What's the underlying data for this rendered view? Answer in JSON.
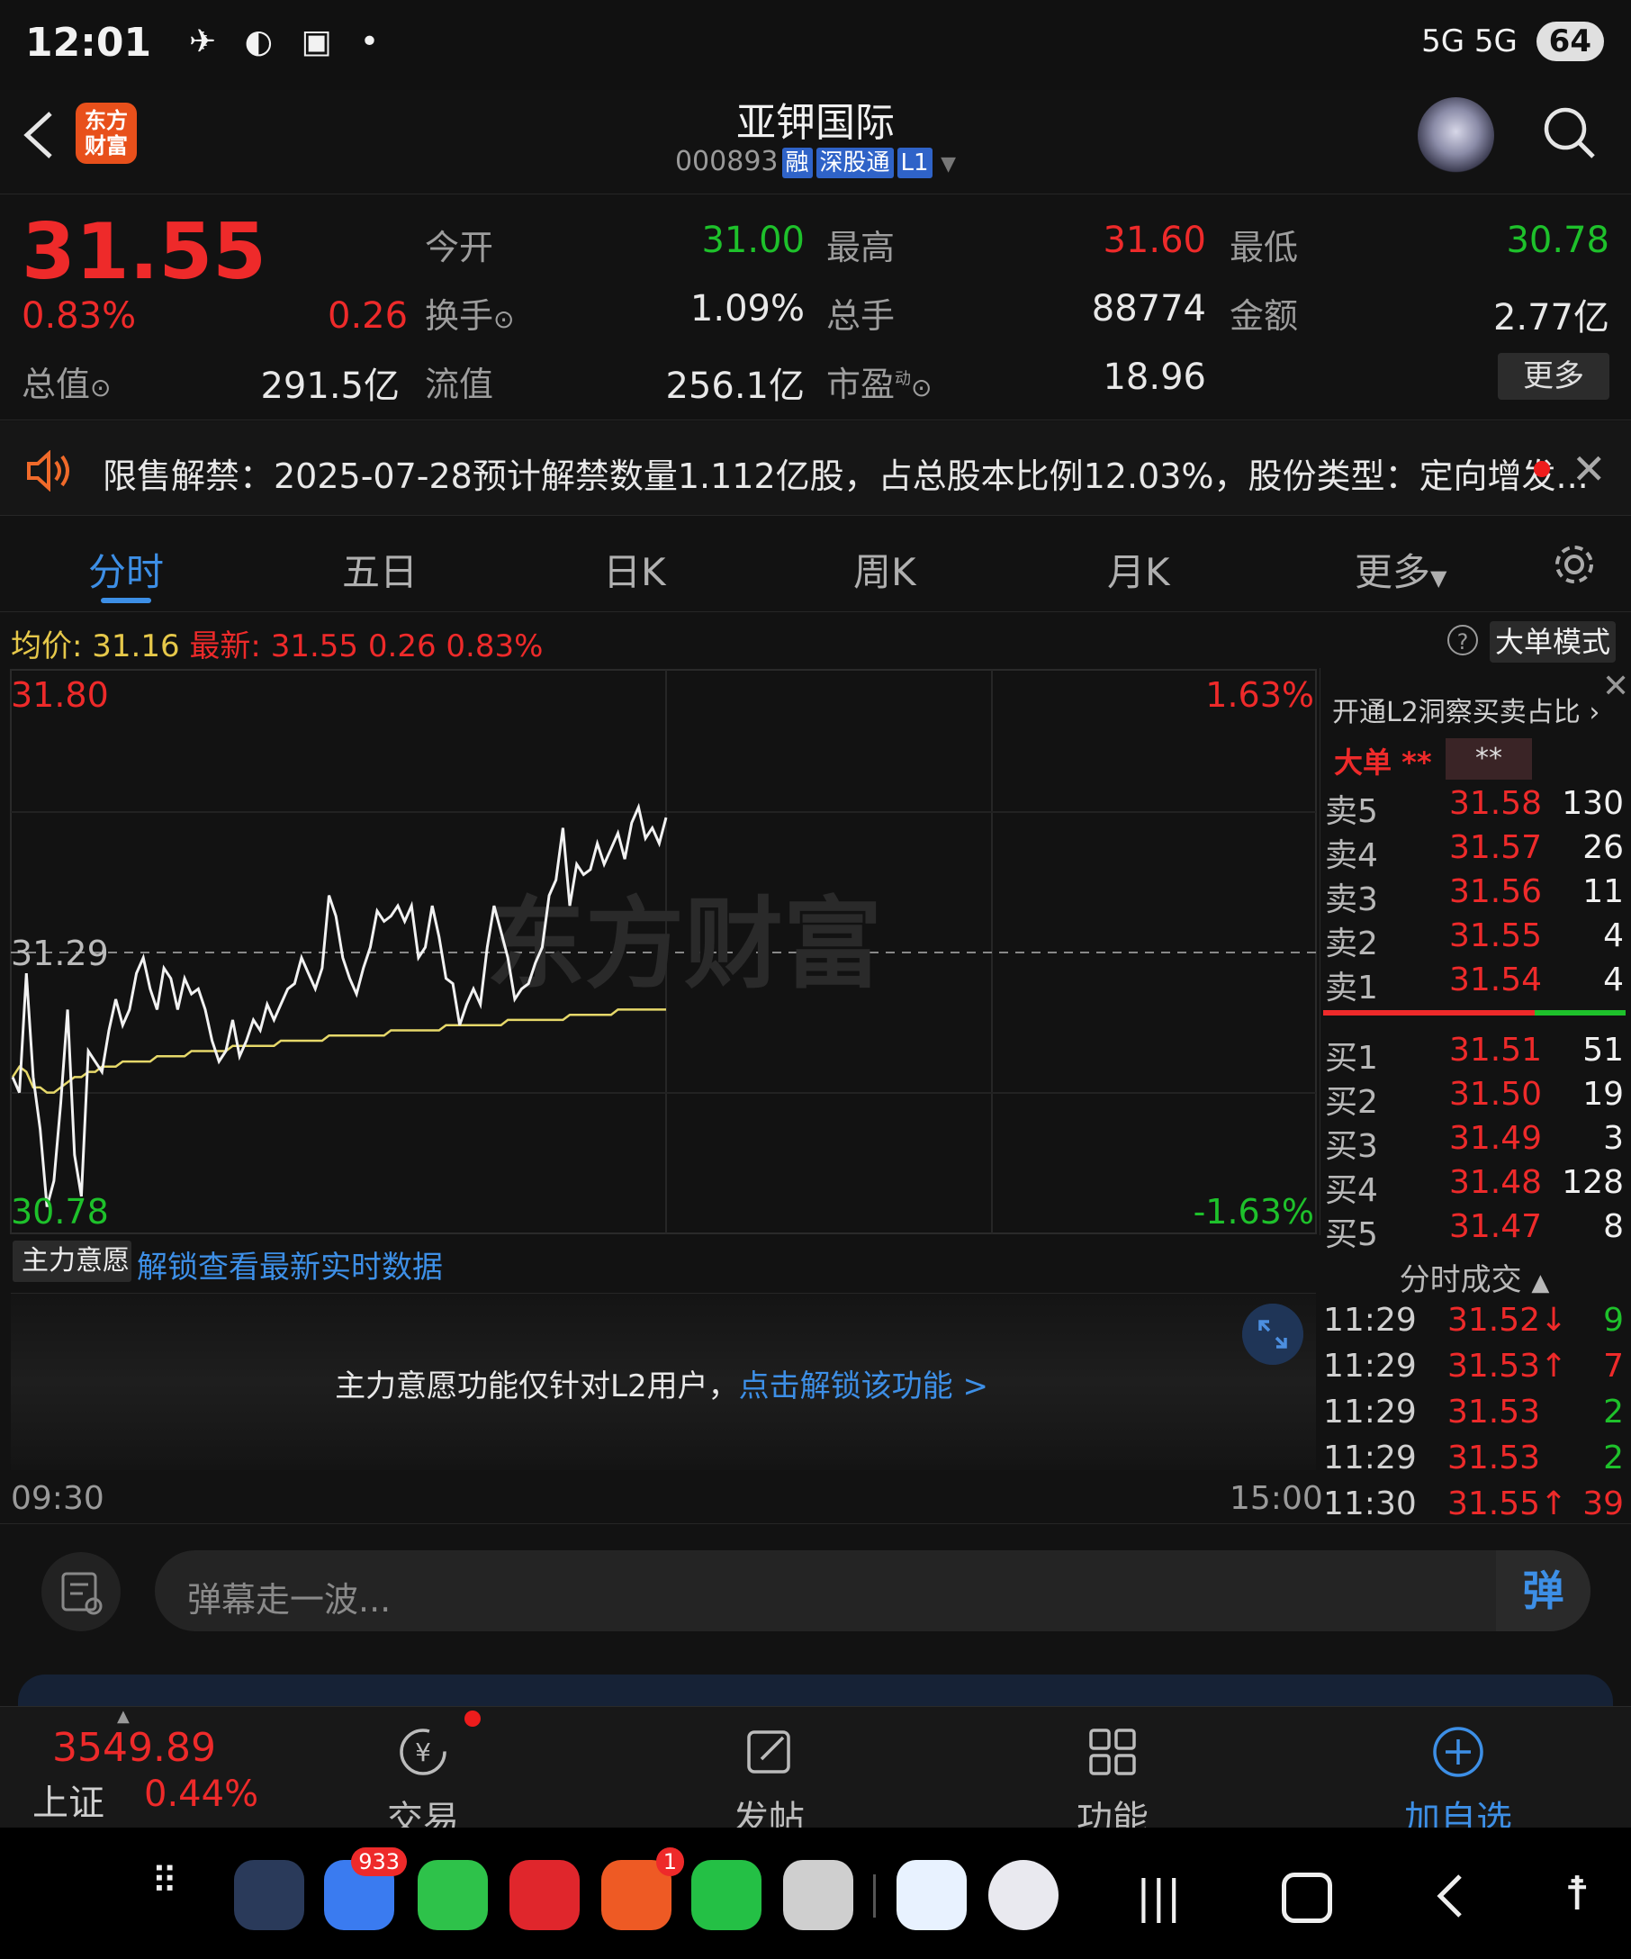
{
  "status_bar": {
    "time": "12:01",
    "network": "5G 5G",
    "battery": "64"
  },
  "header": {
    "logo_text": "东方\n财富",
    "stock_name": "亚钾国际",
    "stock_code": "000893",
    "tags": [
      "融",
      "深股通",
      "L1"
    ]
  },
  "quote": {
    "price": "31.55",
    "change_pct": "0.83%",
    "change": "0.26",
    "open_label": "今开",
    "open": "31.00",
    "high_label": "最高",
    "high": "31.60",
    "low_label": "最低",
    "low": "30.78",
    "turnover_label": "换手",
    "turnover": "1.09%",
    "volume_label": "总手",
    "volume": "88774",
    "amount_label": "金额",
    "amount": "2.77亿",
    "mktcap_label": "总值",
    "mktcap": "291.5亿",
    "float_label": "流值",
    "float_cap": "256.1亿",
    "pe_label": "市盈",
    "pe_super": "动",
    "pe": "18.96",
    "more_label": "更多"
  },
  "notice": {
    "text": "限售解禁：2025-07-28预计解禁数量1.112亿股，占总股本比例12.03%，股份类型：定向增发..."
  },
  "tabs": [
    "分时",
    "五日",
    "日K",
    "周K",
    "月K",
    "更多"
  ],
  "chart_info": {
    "avg_label": "均价:",
    "avg": "31.16",
    "latest_label": "最新:",
    "latest": "31.55",
    "change": "0.26",
    "pct": "0.83%",
    "mode_button": "大单模式"
  },
  "chart_data": {
    "type": "line",
    "y_top": "31.80",
    "y_mid": "31.29",
    "y_bottom": "30.78",
    "pct_top": "1.63%",
    "pct_bottom": "-1.63%",
    "ylim": [
      30.78,
      31.8
    ],
    "x_start": "09:30",
    "x_end": "15:00",
    "watermark": "东方财富",
    "series": [
      {
        "values": [
          31.05,
          31.02,
          31.25,
          31.05,
          30.95,
          30.8,
          30.85,
          31.0,
          31.18,
          30.9,
          30.82,
          31.1,
          31.08,
          31.06,
          31.14,
          31.2,
          31.15,
          31.18,
          31.25,
          31.28,
          31.22,
          31.18,
          31.26,
          31.24,
          31.18,
          31.24,
          31.21,
          31.22,
          31.18,
          31.12,
          31.08,
          31.1,
          31.16,
          31.09,
          31.12,
          31.16,
          31.14,
          31.19,
          31.16,
          31.19,
          31.22,
          31.23,
          31.28,
          31.25,
          31.22,
          31.26,
          31.4,
          31.36,
          31.28,
          31.24,
          31.21,
          31.26,
          31.3,
          31.37,
          31.35,
          31.36,
          31.38,
          31.35,
          31.38,
          31.28,
          31.3,
          31.38,
          31.32,
          31.24,
          31.23,
          31.15,
          31.19,
          31.22,
          31.19,
          31.3,
          31.38,
          31.33,
          31.28,
          31.2,
          31.22,
          31.23,
          31.27,
          31.3,
          31.4,
          31.43,
          31.53,
          31.38,
          31.46,
          31.44,
          31.45,
          31.5,
          31.46,
          31.49,
          31.52,
          31.47,
          31.54,
          31.57,
          31.51,
          31.53,
          31.5,
          31.55
        ]
      },
      {
        "values": [
          31.05,
          31.07,
          31.06,
          31.03,
          31.03,
          31.02,
          31.02,
          31.03,
          31.04,
          31.05,
          31.05,
          31.06,
          31.06,
          31.07,
          31.07,
          31.07,
          31.08,
          31.08,
          31.08,
          31.08,
          31.08,
          31.09,
          31.09,
          31.09,
          31.09,
          31.09,
          31.1,
          31.1,
          31.1,
          31.1,
          31.1,
          31.1,
          31.11,
          31.11,
          31.11,
          31.11,
          31.11,
          31.11,
          31.11,
          31.12,
          31.12,
          31.12,
          31.12,
          31.12,
          31.12,
          31.12,
          31.13,
          31.13,
          31.13,
          31.13,
          31.13,
          31.13,
          31.13,
          31.13,
          31.13,
          31.14,
          31.14,
          31.14,
          31.14,
          31.14,
          31.14,
          31.14,
          31.14,
          31.15,
          31.15,
          31.15,
          31.15,
          31.15,
          31.15,
          31.15,
          31.15,
          31.15,
          31.16,
          31.16,
          31.16,
          31.16,
          31.16,
          31.16,
          31.16,
          31.16,
          31.16,
          31.17,
          31.17,
          31.17,
          31.17,
          31.17,
          31.17,
          31.17,
          31.18,
          31.18,
          31.18,
          31.18,
          31.18,
          31.18,
          31.18,
          31.18
        ]
      }
    ]
  },
  "order_book": {
    "header": "开通L2洞察买卖占比",
    "big_order_label": "大单",
    "big_order_stars": "**",
    "big_order_box": "**",
    "asks": [
      {
        "label": "卖5",
        "price": "31.58",
        "vol": "130"
      },
      {
        "label": "卖4",
        "price": "31.57",
        "vol": "26"
      },
      {
        "label": "卖3",
        "price": "31.56",
        "vol": "11"
      },
      {
        "label": "卖2",
        "price": "31.55",
        "vol": "4"
      },
      {
        "label": "卖1",
        "price": "31.54",
        "vol": "4"
      }
    ],
    "bids": [
      {
        "label": "买1",
        "price": "31.51",
        "vol": "51"
      },
      {
        "label": "买2",
        "price": "31.50",
        "vol": "19"
      },
      {
        "label": "买3",
        "price": "31.49",
        "vol": "3"
      },
      {
        "label": "买4",
        "price": "31.48",
        "vol": "128"
      },
      {
        "label": "买5",
        "price": "31.47",
        "vol": "8"
      }
    ],
    "ask_ratio": 0.7
  },
  "trades": {
    "title": "分时成交",
    "rows": [
      {
        "time": "11:29",
        "price": "31.52↓",
        "vol": "9",
        "vol_color": "#1ec12b"
      },
      {
        "time": "11:29",
        "price": "31.53↑",
        "vol": "7",
        "vol_color": "#ee2a2a"
      },
      {
        "time": "11:29",
        "price": "31.53",
        "vol": "2",
        "vol_color": "#1ec12b"
      },
      {
        "time": "11:29",
        "price": "31.53",
        "vol": "2",
        "vol_color": "#1ec12b"
      },
      {
        "time": "11:30",
        "price": "31.55↑",
        "vol": "39",
        "vol_color": "#ee2a2a"
      }
    ]
  },
  "intent": {
    "dropdown": "主力意愿",
    "unlock_link": "解锁查看最新实时数据",
    "message": "主力意愿功能仅针对L2用户，",
    "message_link": "点击解锁该功能 >"
  },
  "danmaku": {
    "placeholder": "弹幕走一波..."
  },
  "bottom_nav": {
    "index_value": "3549.89",
    "index_name": "上证",
    "index_pct": "0.44%",
    "items": [
      "交易",
      "发帖",
      "功能",
      "加自选"
    ]
  },
  "dock": {
    "badge_chat": "933",
    "badge_app": "1"
  }
}
